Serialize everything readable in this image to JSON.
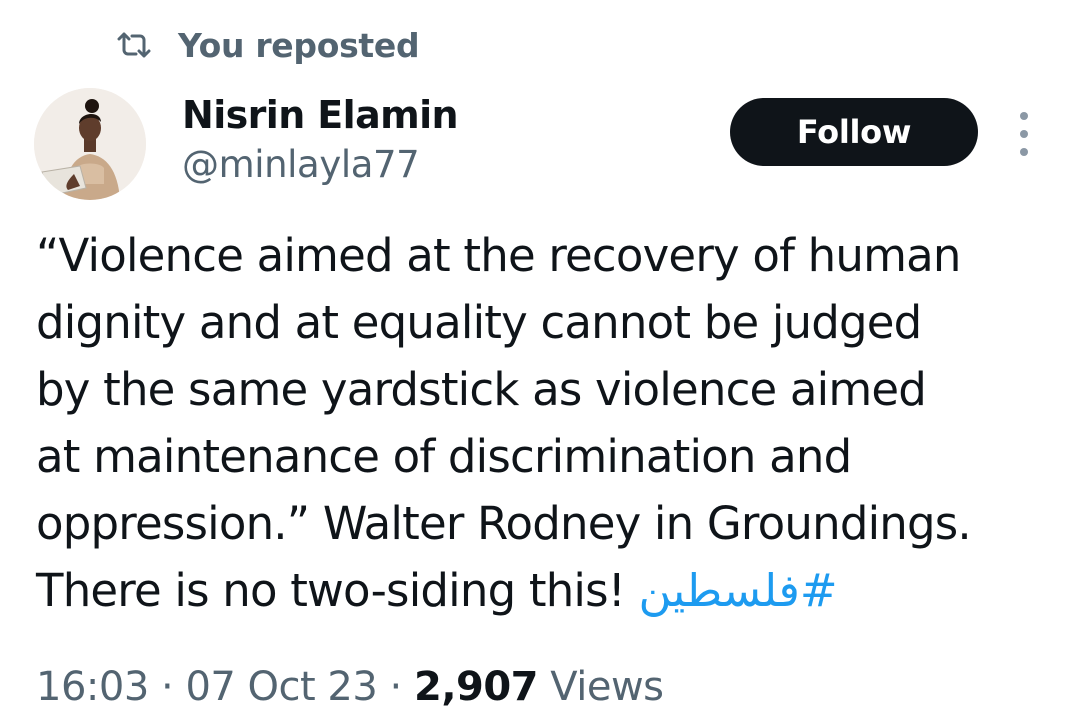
{
  "repost_header": {
    "icon": "repost-icon",
    "text": "You reposted"
  },
  "author": {
    "name": "Nisrin Elamin",
    "handle": "@minlayla77",
    "avatar_icon": "avatar-photo"
  },
  "actions": {
    "follow_label": "Follow",
    "more_icon": "more-vertical-icon"
  },
  "tweet": {
    "lines": [
      "“Violence aimed at the recovery of human",
      "dignity and at equality cannot be judged",
      "by the same yardstick as violence aimed",
      "at maintenance of discrimination and",
      "oppression.” Walter Rodney in Groundings.",
      "There is no two-siding this! "
    ],
    "hashtag": "#فلسطين"
  },
  "meta": {
    "time": "16:03",
    "separator": "·",
    "date": "07 Oct 23",
    "views_count": "2,907",
    "views_label": "Views"
  },
  "colors": {
    "text_primary": "#0f1419",
    "text_secondary": "#536471",
    "accent": "#1d9bf0",
    "button_bg": "#0f1419"
  }
}
